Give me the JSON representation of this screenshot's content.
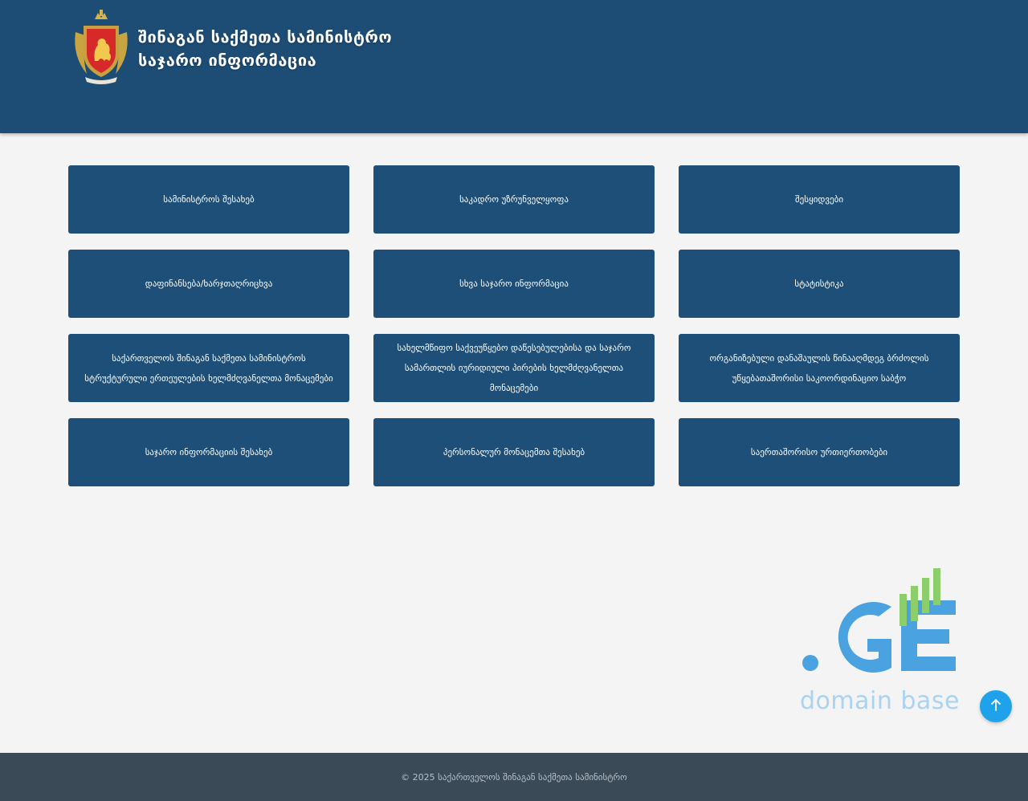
{
  "header": {
    "title_line1": "შინაგან საქმეთა სამინისტრო",
    "title_line2": "საჯარო ინფორმაცია",
    "emblem_icon": "ministry-emblem-icon",
    "background": "#1d4d75"
  },
  "tiles": [
    {
      "label": "სამინისტროს შესახებ"
    },
    {
      "label": "საკადრო უზრუნველყოფა"
    },
    {
      "label": "შესყიდვები"
    },
    {
      "label": "დაფინანსება/ხარჯთაღრიცხვა"
    },
    {
      "label": "სხვა საჯარო ინფორმაცია"
    },
    {
      "label": "სტატისტიკა"
    },
    {
      "label": "საქართველოს შინაგან საქმეთა სამინისტროს სტრუქტურული ერთეულების ხელმძღვანელთა მონაცემები"
    },
    {
      "label": "სახელმწიფო საქვეუწყებო დაწესებულებისა და საჯარო სამართლის იურიდიული პირების ხელმძღვანელთა მონაცემები"
    },
    {
      "label": "ორგანიზებული დანაშაულის წინააღმდეგ ბრძოლის უწყებათაშორისი საკოორდინაციო საბჭო"
    },
    {
      "label": "საჯარო ინფორმაციის შესახებ"
    },
    {
      "label": "პერსონალურ მონაცემთა შესახებ"
    },
    {
      "label": "საერთაშორისო ურთიერთობები"
    }
  ],
  "domain_badge": {
    "mark": ".GE",
    "text": "domain base",
    "colors": {
      "blue": "#4aa3e0",
      "green": "#8ccf6a",
      "text": "#a9d3ef"
    }
  },
  "scroll_top": {
    "icon": "arrow-up-icon",
    "color": "#1ea3ea"
  },
  "footer": {
    "copyright": "© 2025 საქართველოს შინაგან საქმეთა სამინისტრო"
  }
}
